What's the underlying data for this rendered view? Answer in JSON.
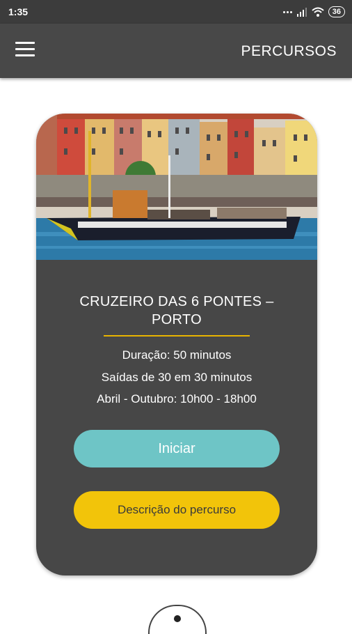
{
  "status_bar": {
    "time": "1:35",
    "battery": "36"
  },
  "app_bar": {
    "title": "PERCURSOS"
  },
  "route_card": {
    "title_line1": "CRUZEIRO DAS 6 PONTES –",
    "title_line2": "PORTO",
    "duration": "Duração: 50 minutos",
    "departures": "Saídas de 30 em 30 minutos",
    "schedule": "Abril - Outubro: 10h00 - 18h00",
    "start_label": "Iniciar",
    "description_label": "Descrição do percurso"
  },
  "colors": {
    "appbar": "#484848",
    "card": "#474747",
    "accent_yellow": "#f2c40a",
    "accent_teal": "#6ec5c6"
  }
}
